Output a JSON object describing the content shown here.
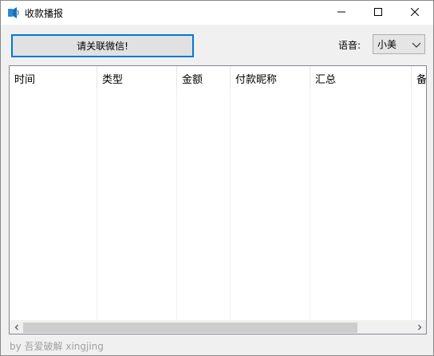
{
  "window": {
    "title": "收款播报"
  },
  "toolbar": {
    "connect_label": "请关联微信!",
    "voice_label": "语音:",
    "voice_selected": "小美"
  },
  "table": {
    "columns": [
      "时间",
      "类型",
      "金额",
      "付款昵称",
      "汇总",
      "备"
    ]
  },
  "footer": {
    "text": "by 吾爱破解 xingjing"
  },
  "colors": {
    "accent": "#0078d7",
    "footer_text": "#a0a0a0"
  },
  "icons": {
    "app": "speaker-icon",
    "minimize": "minimize-icon",
    "maximize": "maximize-icon",
    "close": "close-icon",
    "dropdown": "chevron-down-icon",
    "scroll_left": "chevron-left-icon",
    "scroll_right": "chevron-right-icon"
  }
}
